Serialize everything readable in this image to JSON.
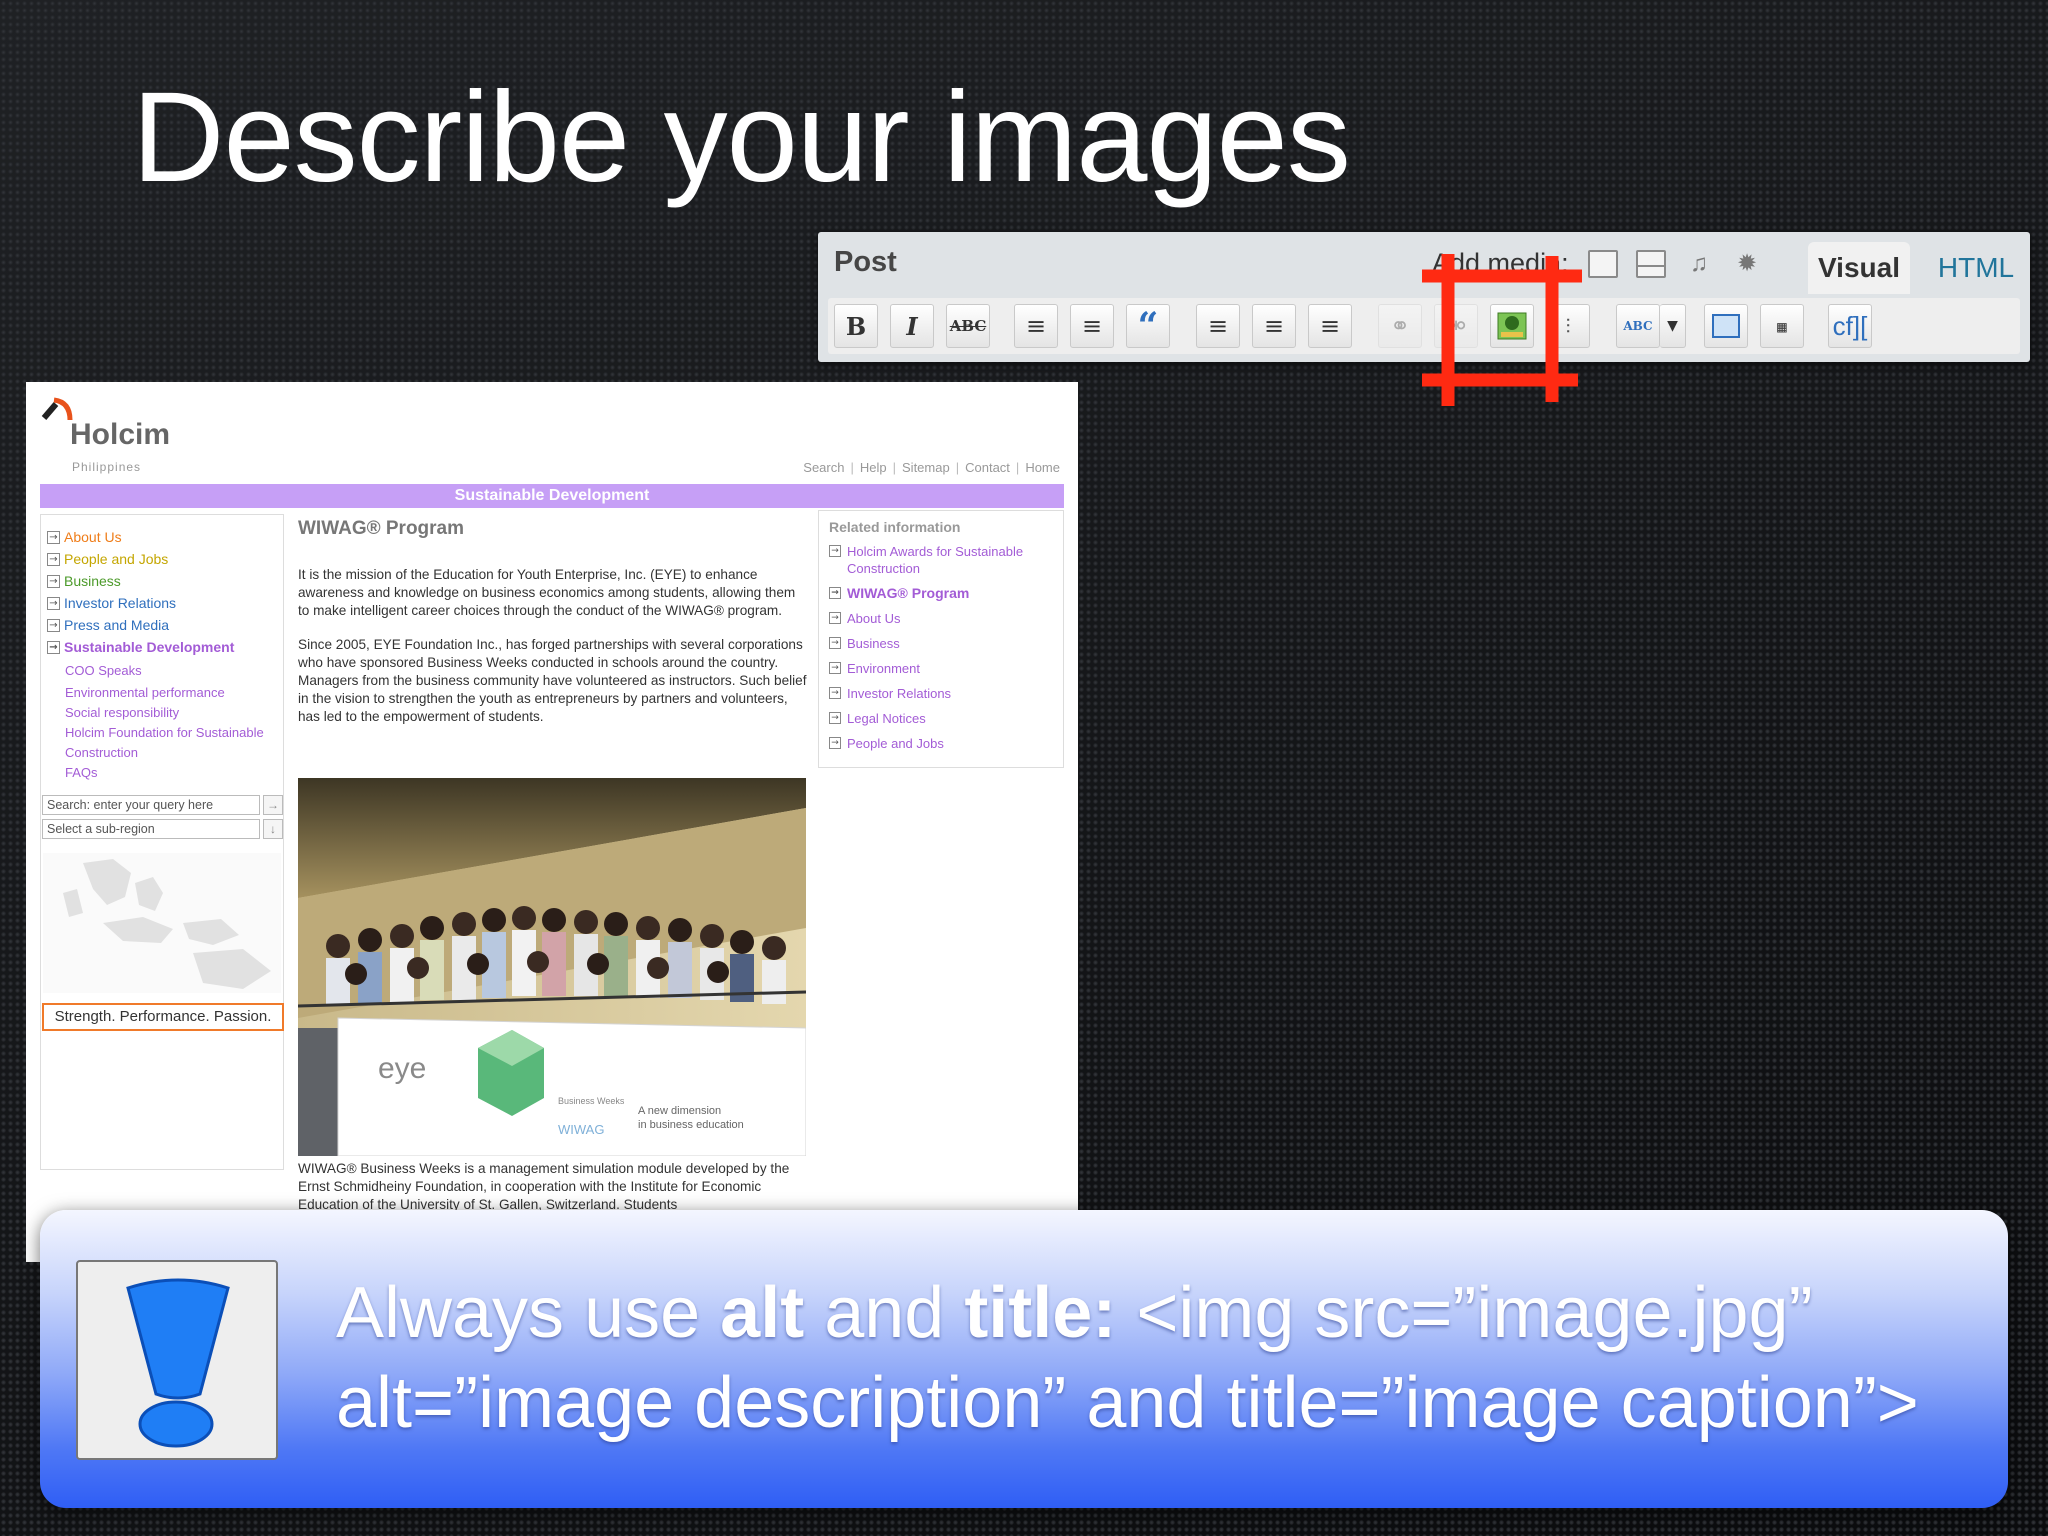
{
  "slide": {
    "title": "Describe your images"
  },
  "editor": {
    "post_label": "Post",
    "add_media_label": "Add media:",
    "tabs": {
      "visual": "Visual",
      "html": "HTML"
    },
    "buttons": {
      "bold": "B",
      "italic": "I",
      "strikethrough": "ABC",
      "bullet_list": "≡",
      "numbered_list": "≡",
      "blockquote": "“",
      "align_left": "≡",
      "align_center": "≡",
      "align_right": "≡",
      "spellcheck": "ABC",
      "cforms": "cf]["
    },
    "icons": [
      "image-icon",
      "gallery-icon",
      "audio-icon",
      "media-icon",
      "link-icon",
      "unlink-icon",
      "insert-image-icon",
      "more-tag-icon",
      "spellcheck-icon",
      "fullscreen-icon",
      "kitchen-sink-icon"
    ]
  },
  "site": {
    "logo": "Holcim",
    "logo_sub": "Philippines",
    "topnav": [
      "Search",
      "Help",
      "Sitemap",
      "Contact",
      "Home"
    ],
    "section_title": "Sustainable Development",
    "leftnav": [
      {
        "label": "About Us",
        "color": "#ef7d1a"
      },
      {
        "label": "People and Jobs",
        "color": "#c4a600"
      },
      {
        "label": "Business",
        "color": "#4c9a2a"
      },
      {
        "label": "Investor Relations",
        "color": "#2f6fbd"
      },
      {
        "label": "Press and Media",
        "color": "#2f6fbd"
      },
      {
        "label": "Sustainable Development",
        "color": "#a35cd6"
      }
    ],
    "subnav": [
      "COO Speaks",
      "Environmental performance",
      "Social responsibility",
      "Holcim Foundation for Sustainable",
      "Construction",
      "FAQs"
    ],
    "search_placeholder": "Search: enter your query here",
    "region_placeholder": "Select a sub-region",
    "search_go": "→",
    "region_go": "↓",
    "tagline": "Strength. Performance. Passion.",
    "content_title": "WIWAG® Program",
    "para1": "It is the mission of the Education for Youth Enterprise, Inc. (EYE) to enhance awareness and knowledge on business economics among students, allowing them to make intelligent career choices through the conduct of the WIWAG® program.",
    "para2": "Since 2005, EYE Foundation Inc., has forged partnerships with several corporations who have sponsored Business Weeks conducted in schools around the country. Managers from the business community have volunteered as instructors. Such belief in the vision to strengthen the youth as entrepreneurs by partners and volunteers, has led to the empowerment of students.",
    "para3": "WIWAG® Business Weeks is a management simulation module developed by the Ernst Schmidheiny Foundation, in cooperation with the Institute for Economic Education of the University of St. Gallen, Switzerland. Students",
    "banner": {
      "logo": "eye",
      "sub1": "Business Weeks",
      "sub2": "A new dimension",
      "sub3": "in business education",
      "brand": "WIWAG"
    },
    "related_title": "Related information",
    "related": [
      {
        "label": "Holcim Awards for Sustainable Construction",
        "bold": false
      },
      {
        "label": "WIWAG® Program",
        "bold": true
      },
      {
        "label": "About Us",
        "bold": false
      },
      {
        "label": "Business",
        "bold": false
      },
      {
        "label": "Environment",
        "bold": false
      },
      {
        "label": "Investor Relations",
        "bold": false
      },
      {
        "label": "Legal Notices",
        "bold": false
      },
      {
        "label": "People and Jobs",
        "bold": false
      }
    ]
  },
  "callout": {
    "line1_prefix": "Always use ",
    "alt_word": "alt",
    "and_word": " and ",
    "title_word": "title:",
    "line1_suffix": " <img src=”image.jpg”",
    "line2": "alt=”image description” and title=”image caption”>"
  },
  "colors": {
    "highlight": "#ff2a12",
    "purple": "#c69ff6",
    "callout_blue": "#2f5ef5"
  }
}
